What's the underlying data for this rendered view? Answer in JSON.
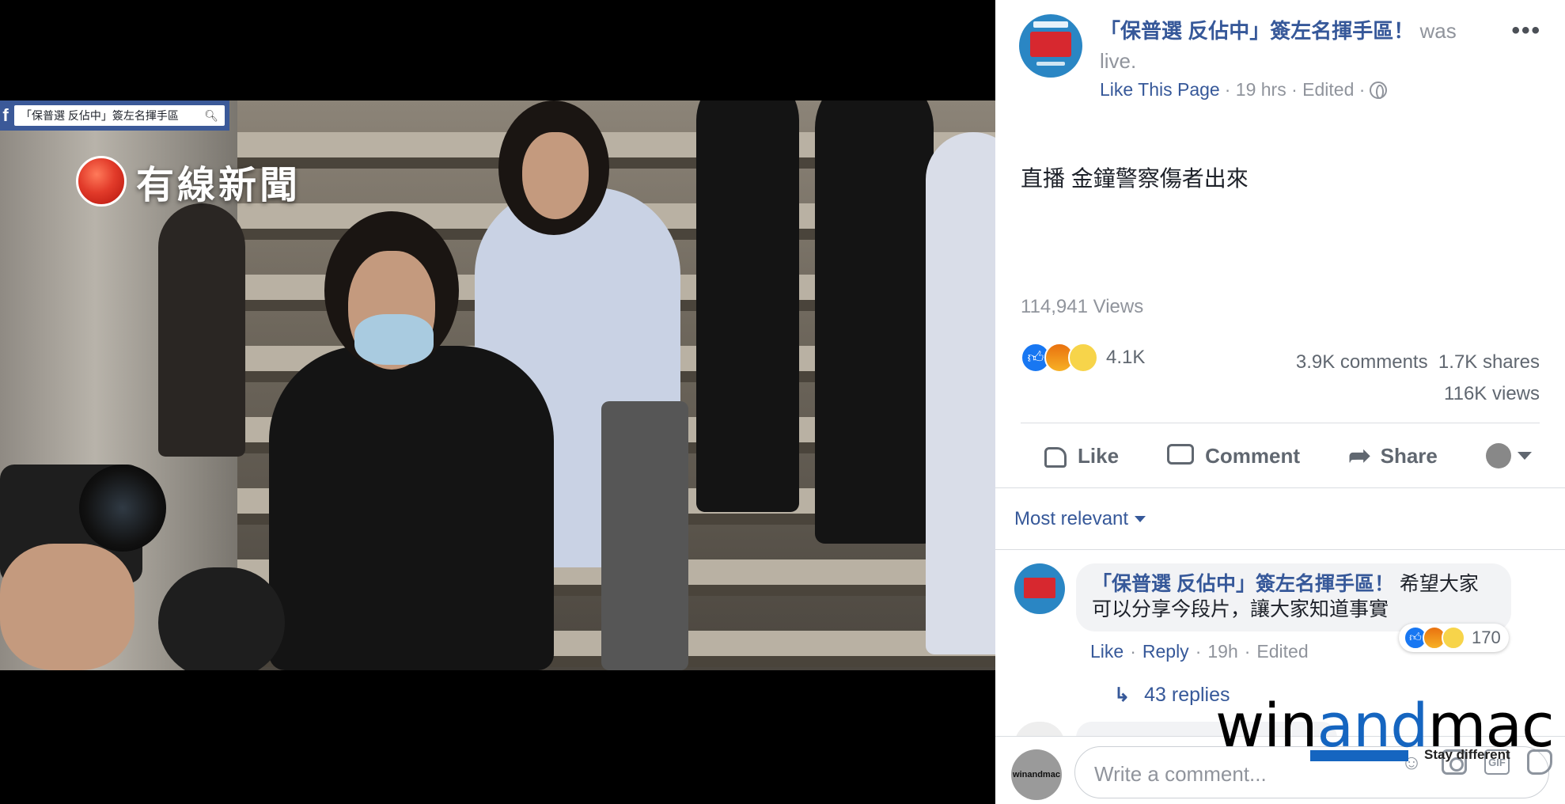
{
  "video": {
    "search_text": "「保普選 反佔中」簽左名揮手區",
    "fb_logo": "f",
    "news_logo": "有線新聞"
  },
  "post": {
    "page_name": "「保普選 反佔中」簽左名揮手區！",
    "status_text": "was live.",
    "like_page": "Like This Page",
    "meta": "· 19 hrs · Edited ·",
    "text": "直播 金鐘警察傷者出來",
    "views": "114,941 Views",
    "reactions_count": "4.1K",
    "comments": "3.9K comments",
    "shares": "1.7K shares",
    "total_views": "116K views",
    "actions": {
      "like": "Like",
      "comment": "Comment",
      "share": "Share"
    },
    "sort": "Most relevant"
  },
  "comment": {
    "author": "「保普選 反佔中」簽左名揮手區！",
    "text": "希望大家可以分享今段片，讓大家知道事實",
    "reaction_count": "170",
    "like": "Like",
    "reply": "Reply",
    "time": "19h",
    "edited": "Edited",
    "replies": "43 replies"
  },
  "composer": {
    "placeholder": "Write a comment...",
    "avatar_text": "winandmac",
    "gif": "GIF"
  },
  "watermark": {
    "win": "win",
    "and": "and",
    "mac": "mac",
    "tagline": "Stay different"
  },
  "colors": {
    "link": "#365899",
    "fb_blue": "#3b5998",
    "muted": "#90949c"
  },
  "icons": [
    "search-icon",
    "globe-icon",
    "more-icon",
    "like-icon",
    "comment-icon",
    "share-icon",
    "caret-down-icon",
    "reply-arrow-icon",
    "emoji-icon",
    "camera-icon",
    "gif-icon",
    "sticker-icon"
  ]
}
